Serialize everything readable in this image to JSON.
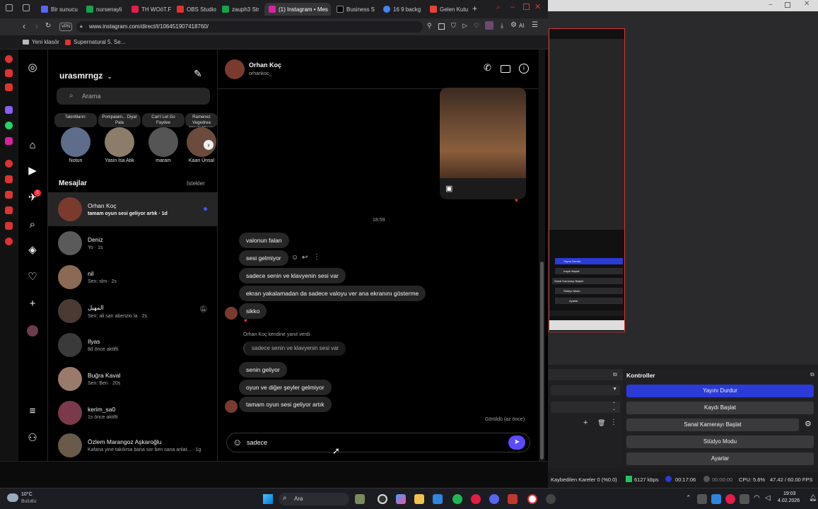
{
  "browser": {
    "tabs": [
      {
        "label": "Bir sunucu",
        "color": "#5865f2"
      },
      {
        "label": "nursenayli",
        "color": "#16a34a"
      },
      {
        "label": "TH WOöT.F",
        "color": "#e11d48"
      },
      {
        "label": "OBS Studio",
        "color": "#d33"
      },
      {
        "label": "zauph3 Str",
        "color": "#16a34a"
      },
      {
        "label": "(1) Instagram • Mes",
        "color": "#d6249f"
      },
      {
        "label": "Business S",
        "color": "#000000"
      },
      {
        "label": "16 9 backg",
        "color": "#4285f4"
      },
      {
        "label": "Gelen Kutu",
        "color": "#ea4335"
      }
    ],
    "vpn_badge": "VPN",
    "url": "www.instagram.com/direct/t/106451907418760/",
    "ai_label": "AI",
    "bookmarks": [
      {
        "label": "Yeni klasör"
      },
      {
        "label": "Supernatural 5. Se..."
      }
    ]
  },
  "instagram": {
    "username": "urasmrngz",
    "search_placeholder": "Arama",
    "notes": [
      {
        "bubble": "Takintiların:",
        "name": "Notun"
      },
      {
        "bubble": "Pompalam... Diyar Pala",
        "name": "Yasin İsa Atik"
      },
      {
        "bubble": "Can't Let Go Faydee",
        "name": "maram"
      },
      {
        "bubble": "Ramenez Vegedrea N'golo N'golo",
        "name": "Kaan Ünsal"
      }
    ],
    "messages_label": "Mesajlar",
    "requests_label": "İstekler",
    "notification_badge": "1",
    "conversations": [
      {
        "name": "Orhan Koç",
        "sub": "tamam oyun sesi geliyor artık · 1d",
        "active": true
      },
      {
        "name": "Deniz",
        "sub": "Yo · 1s"
      },
      {
        "name": "nil",
        "sub": "Sen: slm · 2s"
      },
      {
        "name": "المهيل",
        "sub": "Sen: ali san abenzio la · 2s"
      },
      {
        "name": "Ilyas",
        "sub": "8d önce aktifti"
      },
      {
        "name": "Buğra Kaval",
        "sub": "Sen: Ben · 20s"
      },
      {
        "name": "kerim_sa0",
        "sub": "1s önce aktifti"
      },
      {
        "name": "Özlem Marangoz Aşkaroğlu",
        "sub": "Kafana yine takılırsa bana sor ben sana anlat... · 1g"
      }
    ],
    "thread": {
      "name": "Orhan Koç",
      "handle": "orhankoc_",
      "timestamp": "18:59",
      "messages": [
        {
          "text": "valonun falan"
        },
        {
          "text": "sesi gelmiyor"
        },
        {
          "text": "sadece senin ve klavyenin sesi var"
        },
        {
          "text": "ekran yakalamadan da sadece valoyu ver ana ekranını gösterme"
        },
        {
          "text": "sikko"
        },
        {
          "text": "senin geliyor"
        },
        {
          "text": "oyun ve diğer şeyler gelmiyor"
        },
        {
          "text": "tamam oyun sesi geliyor artık"
        }
      ],
      "reply_context": "Orhan Koç kendine yanıt verdi",
      "reply_quote": "sadece senin ve klavyenin sesi var",
      "seen_label": "Görüldü (az önce)",
      "composer_value": "sadece"
    }
  },
  "obs": {
    "controls_title": "Kontroller",
    "buttons": [
      "Yayını Durdur",
      "Kaydı Başlat",
      "Sanal Kamerayı Başlat",
      "Stüdyo Modu",
      "Ayarlar"
    ],
    "mini_buttons": [
      "Yayını Durdur",
      "Kaydı Başlat",
      "Sanal Kamerayı Başlat",
      "Stüdyo Modu",
      "Ayarlar"
    ],
    "status": {
      "dropped": "Kaybedilen Kareler 0 (%0.0)",
      "bitrate": "6127 kbps",
      "live_time": "00:17:06",
      "rec_time": "00:00:00",
      "cpu": "CPU: 5.6%",
      "fps": "47.42 / 60.00 FPS"
    },
    "accent": "#2a3bd7"
  },
  "taskbar": {
    "weather_temp": "10°C",
    "weather_desc": "Bulutlu",
    "search_label": "Ara",
    "time": "19:03",
    "date": "4.02.2026"
  }
}
